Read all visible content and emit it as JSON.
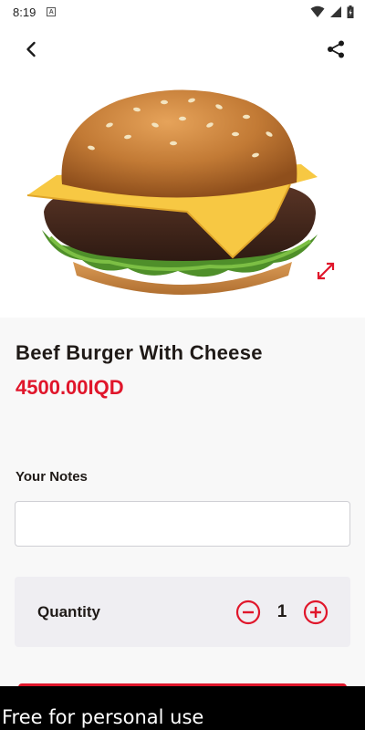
{
  "status_bar": {
    "time": "8:19",
    "notification_icon": "a-badge-icon"
  },
  "app_bar": {
    "back_icon": "back-arrow-icon",
    "share_icon": "share-icon"
  },
  "product": {
    "image_alt": "beef-burger-with-cheese-photo",
    "name": "Beef Burger With Cheese",
    "price": "4500.00IQD"
  },
  "notes": {
    "label": "Your Notes",
    "value": "",
    "placeholder": ""
  },
  "quantity": {
    "label": "Quantity",
    "value": "1"
  },
  "watermark": {
    "text": "Free for personal use"
  },
  "colors": {
    "accent": "#e0162b",
    "card_bg": "#efeef2",
    "text": "#1f1a17"
  }
}
